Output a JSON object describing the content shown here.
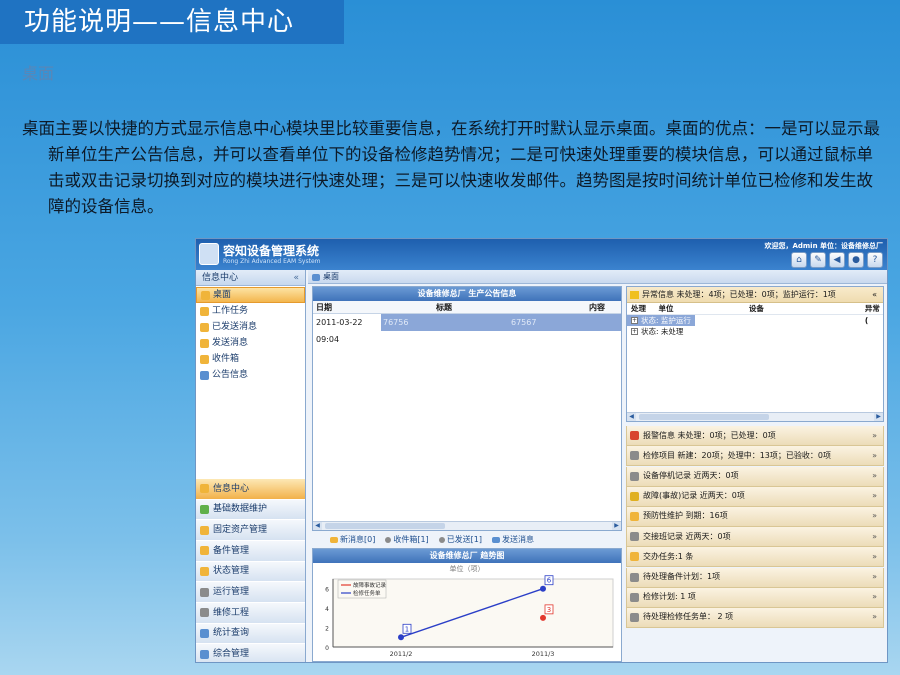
{
  "slide": {
    "title": "功能说明——信息中心",
    "subtitle": "桌面",
    "description": "桌面主要以快捷的方式显示信息中心模块里比较重要信息，在系统打开时默认显示桌面。桌面的优点：一是可以显示最新单位生产公告信息，并可以查看单位下的设备检修趋势情况；二是可快速处理重要的模块信息，可以通过鼠标单击或双击记录切换到对应的模块进行快速处理；三是可以快速收发邮件。趋势图是按时间统计单位已检修和发生故障的设备信息。"
  },
  "app": {
    "title": "容知设备管理系统",
    "subtitle": "Rong Zhi Advanced EAM System",
    "welcome": "欢迎您，Admin  单位：设备维修总厂"
  },
  "sidebar": {
    "header": "信息中心",
    "collapse": "«",
    "items": [
      {
        "label": "桌面"
      },
      {
        "label": "工作任务"
      },
      {
        "label": "已发送消息"
      },
      {
        "label": "发送消息"
      },
      {
        "label": "收件箱"
      },
      {
        "label": "公告信息"
      }
    ],
    "modules": [
      {
        "label": "信息中心"
      },
      {
        "label": "基础数据维护"
      },
      {
        "label": "固定资产管理"
      },
      {
        "label": "备件管理"
      },
      {
        "label": "状态管理"
      },
      {
        "label": "运行管理"
      },
      {
        "label": "维修工程"
      },
      {
        "label": "统计查询"
      },
      {
        "label": "综合管理"
      }
    ]
  },
  "tab": {
    "label": "桌面"
  },
  "notice": {
    "title": "设备维修总厂  生产公告信息",
    "col_date": "日期",
    "col_title": "标题",
    "col_content": "内容",
    "row": {
      "date": "2011-03-22 09:04",
      "title": "76756",
      "content": "67567"
    }
  },
  "mail": {
    "new": "新消息[0]",
    "inbox": "收件箱[1]",
    "sent": "已发送[1]",
    "send": "发送消息"
  },
  "trend": {
    "title": "设备维修总厂  趋势图"
  },
  "chart_data": {
    "type": "line",
    "title": "单位（项）",
    "categories": [
      "2011/2",
      "2011/3"
    ],
    "series": [
      {
        "name": "故障事故记录",
        "values": [
          null,
          3
        ],
        "color": "#e2382d"
      },
      {
        "name": "检修任务单",
        "values": [
          1,
          6
        ],
        "color": "#2b3fc7"
      }
    ],
    "ylim": [
      0,
      7
    ],
    "yticks": [
      "0",
      "2",
      "4",
      "6"
    ]
  },
  "abnormal": {
    "header": "异常信息  未处理：4项；已处理：0项；监护运行：1项",
    "expand": "»",
    "cols": [
      "处理",
      "单位",
      "设备",
      "异常("
    ],
    "tree": [
      {
        "label": "状态: 监护运行"
      },
      {
        "label": "状态: 未处理"
      }
    ]
  },
  "quick": [
    {
      "label": "报警信息  未处理：0项；已处理：0项",
      "icon": "alarm-icon"
    },
    {
      "label": "检修项目  新建：20项；处理中：13项；已验收：0项",
      "icon": "repair-icon"
    },
    {
      "label": "设备停机记录  近两天：0项",
      "icon": "shutdown-icon"
    },
    {
      "label": "故障(事故)记录  近两天：0项",
      "icon": "fault-icon"
    },
    {
      "label": "预防性维护  到期：16项",
      "icon": "warning-icon"
    },
    {
      "label": "交接班记录  近两天：0项",
      "icon": "handover-icon"
    },
    {
      "label": "交办任务:1 条",
      "icon": "task-icon"
    },
    {
      "label": "待处理备件计划：1项",
      "icon": "spare-icon"
    },
    {
      "label": "检修计划: 1 项",
      "icon": "plan-icon"
    },
    {
      "label": "待处理检修任务单：  2 项",
      "icon": "order-icon"
    }
  ],
  "colors": {
    "accent": "#1f73c2",
    "selected": "#f3b64e"
  }
}
